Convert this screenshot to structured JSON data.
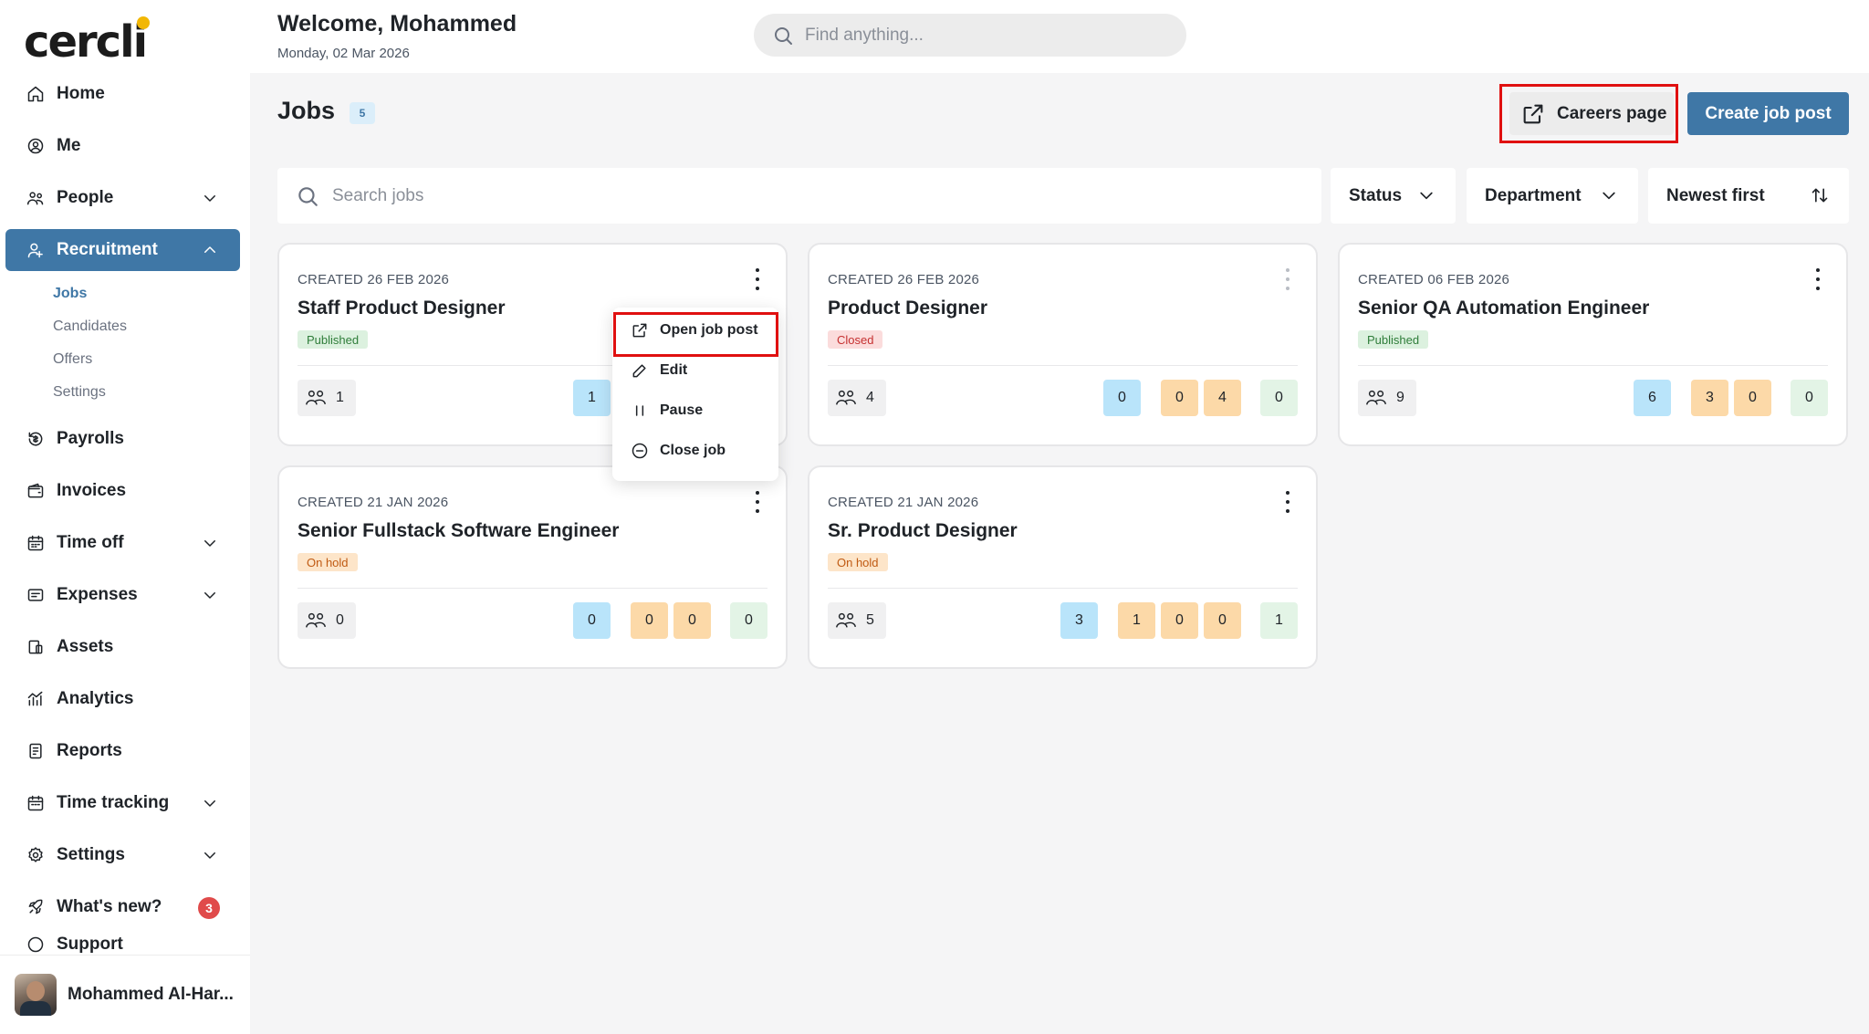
{
  "brand": {
    "logo_text": "cercli"
  },
  "header": {
    "welcome": "Welcome, Mohammed",
    "date": "Monday, 02 Mar 2026",
    "search_placeholder": "Find anything..."
  },
  "sidebar": {
    "items": [
      {
        "label": "Home",
        "icon": "home-icon"
      },
      {
        "label": "Me",
        "icon": "user-circle-icon"
      },
      {
        "label": "People",
        "icon": "people-icon",
        "expandable": true
      },
      {
        "label": "Recruitment",
        "icon": "recruitment-icon",
        "expandable": true,
        "active": true
      },
      {
        "label": "Payrolls",
        "icon": "payroll-icon"
      },
      {
        "label": "Invoices",
        "icon": "wallet-icon"
      },
      {
        "label": "Time off",
        "icon": "calendar-icon",
        "expandable": true
      },
      {
        "label": "Expenses",
        "icon": "expenses-icon",
        "expandable": true
      },
      {
        "label": "Assets",
        "icon": "assets-icon"
      },
      {
        "label": "Analytics",
        "icon": "analytics-icon"
      },
      {
        "label": "Reports",
        "icon": "reports-icon"
      },
      {
        "label": "Time tracking",
        "icon": "calendar-icon",
        "expandable": true
      },
      {
        "label": "Settings",
        "icon": "gear-icon",
        "expandable": true
      },
      {
        "label": "What's new?",
        "icon": "rocket-icon",
        "badge": "3"
      },
      {
        "label": "Support",
        "icon": "support-icon"
      }
    ],
    "recruitment_sub": [
      "Jobs",
      "Candidates",
      "Offers",
      "Settings"
    ],
    "user_name": "Mohammed Al-Har..."
  },
  "jobs_page": {
    "title": "Jobs",
    "count": "5",
    "careers_label": "Careers page",
    "create_label": "Create job post",
    "search_placeholder": "Search jobs",
    "filters": {
      "status": "Status",
      "department": "Department",
      "sort": "Newest first"
    }
  },
  "jobs": [
    {
      "created": "CREATED 26 FEB 2026",
      "title": "Staff Product Designer",
      "status": "Published",
      "status_type": "published",
      "applicants": "1",
      "stages": [
        "1"
      ]
    },
    {
      "created": "CREATED 26 FEB 2026",
      "title": "Product Designer",
      "status": "Closed",
      "status_type": "closed",
      "applicants": "4",
      "stages": [
        "0",
        "0",
        "4",
        "0"
      ]
    },
    {
      "created": "CREATED 06 FEB 2026",
      "title": "Senior QA Automation Engineer",
      "status": "Published",
      "status_type": "published",
      "applicants": "9",
      "stages": [
        "6",
        "3",
        "0",
        "0"
      ]
    },
    {
      "created": "CREATED 21 JAN 2026",
      "title": "Senior Fullstack Software Engineer",
      "status": "On hold",
      "status_type": "onhold",
      "applicants": "0",
      "stages": [
        "0",
        "0",
        "0",
        "0"
      ]
    },
    {
      "created": "CREATED 21 JAN 2026",
      "title": "Sr. Product Designer",
      "status": "On hold",
      "status_type": "onhold",
      "applicants": "5",
      "stages": [
        "3",
        "1",
        "0",
        "0",
        "1"
      ]
    }
  ],
  "context_menu": [
    "Open job post",
    "Edit",
    "Pause",
    "Close job"
  ],
  "colors": {
    "accent": "#3f77a6",
    "highlight": "#e01010",
    "stage_blue": "#b9e4fa",
    "stage_orange": "#fcd9a8",
    "stage_green": "#e3f4e6"
  }
}
